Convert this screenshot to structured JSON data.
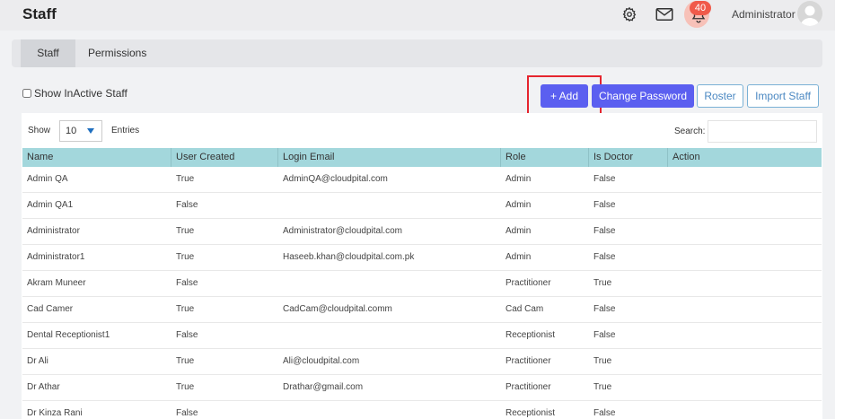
{
  "header": {
    "title": "Staff",
    "notifications_count": "40",
    "user_name": "Administrator"
  },
  "tabs": [
    {
      "label": "Staff",
      "active": true
    },
    {
      "label": "Permissions",
      "active": false
    }
  ],
  "toolbar": {
    "show_inactive_label": "Show InActive Staff",
    "add_label": "+ Add",
    "change_password_label": "Change Password",
    "roster_label": "Roster",
    "import_label": "Import Staff"
  },
  "table_controls": {
    "show_label": "Show",
    "entries_value": "10",
    "entries_label": "Entries",
    "search_label": "Search:"
  },
  "table": {
    "columns": [
      "Name",
      "User Created",
      "Login Email",
      "Role",
      "Is Doctor",
      "Action"
    ],
    "rows": [
      [
        "Admin QA",
        "True",
        "AdminQA@cloudpital.com",
        "Admin",
        "False",
        ""
      ],
      [
        "Admin QA1",
        "False",
        "",
        "Admin",
        "False",
        ""
      ],
      [
        "Administrator",
        "True",
        "Administrator@cloudpital.com",
        "Admin",
        "False",
        ""
      ],
      [
        "Administrator1",
        "True",
        "Haseeb.khan@cloudpital.com.pk",
        "Admin",
        "False",
        ""
      ],
      [
        "Akram Muneer",
        "False",
        "",
        "Practitioner",
        "True",
        ""
      ],
      [
        "Cad Camer",
        "True",
        "CadCam@cloudpital.comm",
        "Cad Cam",
        "False",
        ""
      ],
      [
        "Dental Receptionist1",
        "False",
        "",
        "Receptionist",
        "False",
        ""
      ],
      [
        "Dr Ali",
        "True",
        "Ali@cloudpital.com",
        "Practitioner",
        "True",
        ""
      ],
      [
        "Dr Athar",
        "True",
        "Drathar@gmail.com",
        "Practitioner",
        "True",
        ""
      ],
      [
        "Dr Kinza Rani",
        "False",
        "",
        "Receptionist",
        "False",
        ""
      ]
    ]
  },
  "colors": {
    "primary_button": "#5b5ff0",
    "table_header": "#a3d7dc",
    "badge": "#f05a4a",
    "highlight": "#e5252e"
  },
  "icons": [
    "gear-icon",
    "mail-icon",
    "bell-icon",
    "avatar-icon",
    "dropdown-caret-icon"
  ]
}
